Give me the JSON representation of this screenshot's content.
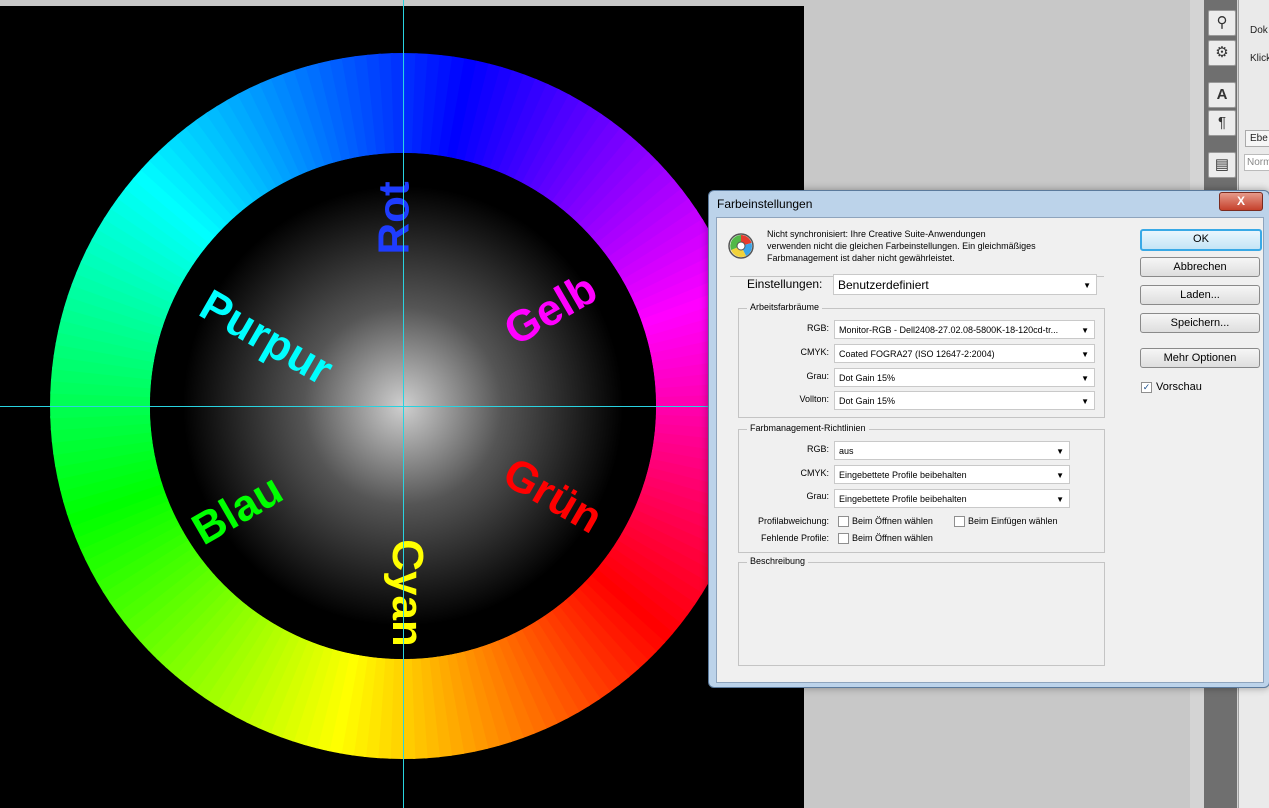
{
  "canvas": {
    "wheel_labels": {
      "red": "Rot",
      "yellow": "Gelb",
      "green": "Grün",
      "cyan": "Cyan",
      "blue": "Blau",
      "magenta": "Purpur"
    },
    "colors": {
      "rot_text": "#1e3cff",
      "gelb_text": "#ff00ff",
      "gruen_text": "#ff0000",
      "cyan_text": "#ffff00",
      "blau_text": "#00ff00",
      "purpur_text": "#00ffff",
      "guide": "#29d3e0"
    }
  },
  "panel": {
    "tab_label": "Ebe",
    "blend_mode": "Norm",
    "doc_label": "Dok",
    "click_label": "Klick"
  },
  "dialog": {
    "title": "Farbeinstellungen",
    "close_symbol": "X",
    "sync_message_line1": "Nicht synchronisiert: Ihre Creative Suite-Anwendungen",
    "sync_message_line2": "verwenden nicht die gleichen Farbeinstellungen. Ein gleichmäßiges",
    "sync_message_line3": "Farbmanagement ist daher nicht gewährleistet.",
    "settings_label": "Einstellungen:",
    "settings_value": "Benutzerdefiniert",
    "working_spaces": {
      "title": "Arbeitsfarbräume",
      "rgb_label": "RGB:",
      "rgb_value": "Monitor-RGB - Dell2408-27.02.08-5800K-18-120cd-tr...",
      "cmyk_label": "CMYK:",
      "cmyk_value": "Coated FOGRA27 (ISO 12647-2:2004)",
      "gray_label": "Grau:",
      "gray_value": "Dot Gain 15%",
      "spot_label": "Vollton:",
      "spot_value": "Dot Gain 15%"
    },
    "policies": {
      "title": "Farbmanagement-Richtlinien",
      "rgb_label": "RGB:",
      "rgb_value": "aus",
      "cmyk_label": "CMYK:",
      "cmyk_value": "Eingebettete Profile beibehalten",
      "gray_label": "Grau:",
      "gray_value": "Eingebettete Profile beibehalten",
      "mismatch_label": "Profilabweichung:",
      "mismatch_open": "Beim Öffnen wählen",
      "mismatch_paste": "Beim Einfügen wählen",
      "missing_label": "Fehlende Profile:",
      "missing_open": "Beim Öffnen wählen"
    },
    "description": {
      "title": "Beschreibung"
    },
    "buttons": {
      "ok": "OK",
      "cancel": "Abbrechen",
      "load": "Laden...",
      "save": "Speichern...",
      "more": "Mehr Optionen"
    },
    "preview_label": "Vorschau",
    "preview_checked": "✓"
  }
}
